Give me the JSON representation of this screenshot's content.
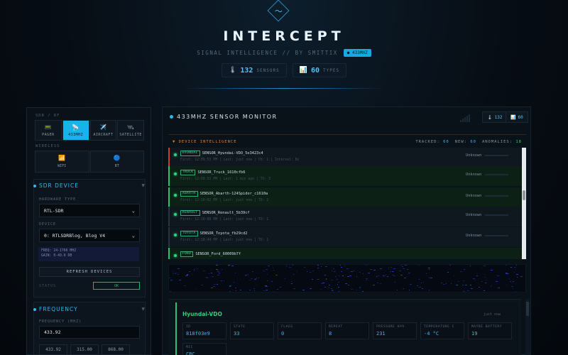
{
  "header": {
    "title": "INTERCEPT",
    "subtitle": "SIGNAL INTELLIGENCE // BY SMITTIX",
    "mode_badge": "● 433MHZ",
    "stats": [
      {
        "icon": "🌡",
        "value": "132",
        "label": "SENSORS"
      },
      {
        "icon": "📊",
        "value": "60",
        "label": "TYPES"
      }
    ]
  },
  "sidebar": {
    "mode_section_label": "SDR / RF",
    "modes": [
      {
        "icon": "📟",
        "label": "PAGER",
        "active": false
      },
      {
        "icon": "📡",
        "label": "433MHZ",
        "active": true
      },
      {
        "icon": "✈️",
        "label": "AIRCRAFT",
        "active": false
      },
      {
        "icon": "🛰",
        "label": "SATELLITE",
        "active": false
      }
    ],
    "wireless_label": "WIRELESS",
    "wireless": [
      {
        "icon": "📶",
        "label": "WIFI"
      },
      {
        "icon": "🔵",
        "label": "BT"
      }
    ],
    "sdr": {
      "title": "SDR DEVICE",
      "hardware_label": "HARDWARE TYPE",
      "hardware_value": "RTL-SDR",
      "device_label": "DEVICE",
      "device_value": "0: RTLSDRBlog, Blog V4",
      "info_line1": "FREQ: 24-1766 MHZ",
      "info_line2": "GAIN: 0-49.6 DB",
      "refresh_label": "REFRESH DEVICES",
      "status_key": "STATUS",
      "status_value": "OK"
    },
    "frequency": {
      "title": "FREQUENCY",
      "label": "FREQUENCY (MHZ)",
      "value": "433.92",
      "presets": [
        "433.92",
        "315.00",
        "868.00"
      ]
    }
  },
  "main": {
    "title": "433MHZ SENSOR MONITOR",
    "counts": [
      {
        "icon": "🌡",
        "value": "132"
      },
      {
        "icon": "📊",
        "value": "60"
      }
    ],
    "intel": {
      "title": "▼ DEVICE INTELLIGENCE",
      "tracked_label": "TRACKED:",
      "tracked": "60",
      "new_label": "NEW:",
      "new": "60",
      "anomalies_label": "ANOMALIES:",
      "anomalies": "18"
    },
    "devices": [
      {
        "tag": "HYUNDAI",
        "name": "SENSOR_Hyundai-VDO_5e3423c4",
        "detail": "First: 12:09:53 PM | Last: just now | Ch: 1 | Interval: 8s",
        "status": "Unknown",
        "accent": "#d23a3a",
        "style": "tone"
      },
      {
        "tag": "TRUCK",
        "name": "SENSOR_Truck_1610cfb6",
        "detail": "First: 12:09:53 PM | Last: 1 min ago | TX: 3",
        "status": "Unknown",
        "accent": "#27c474",
        "style": "hl"
      },
      {
        "tag": "ABARTH",
        "name": "SENSOR_Abarth-124Spider_c1610a",
        "detail": "First: 12:10:02 PM | Last: just now | TX: 2",
        "status": "Unknown",
        "accent": "#27c474",
        "style": "hl"
      },
      {
        "tag": "RENAULT",
        "name": "SENSOR_Renault_5b39cf",
        "detail": "First: 12:10:08 PM | Last: just now | TX: 1",
        "status": "Unknown",
        "accent": "#2a3541",
        "style": "tone"
      },
      {
        "tag": "TOYOTA",
        "name": "SENSOR_Toyota_fb29cd2",
        "detail": "First: 12:10:44 PM | Last: just now | TX: 1",
        "status": "Unknown",
        "accent": "#2a3541",
        "style": "tone"
      },
      {
        "tag": "FORD",
        "name": "SENSOR_Ford_60009b7f",
        "detail": "",
        "status": "",
        "accent": "#27c474",
        "style": "hl"
      }
    ],
    "detail": {
      "name": "Hyundai-VDO",
      "meta": "just now",
      "fields": [
        {
          "key": "ID",
          "value": "818f03e9"
        },
        {
          "key": "STATE",
          "value": "33"
        },
        {
          "key": "FLAGS",
          "value": "0"
        },
        {
          "key": "REPEAT",
          "value": "8"
        },
        {
          "key": "PRESSURE KPA",
          "value": "231"
        },
        {
          "key": "TEMPERATURE C",
          "value": "-4 °C"
        },
        {
          "key": "MAYBE BATTERY",
          "value": "19"
        },
        {
          "key": "MIC",
          "value": "CRC"
        }
      ]
    }
  }
}
